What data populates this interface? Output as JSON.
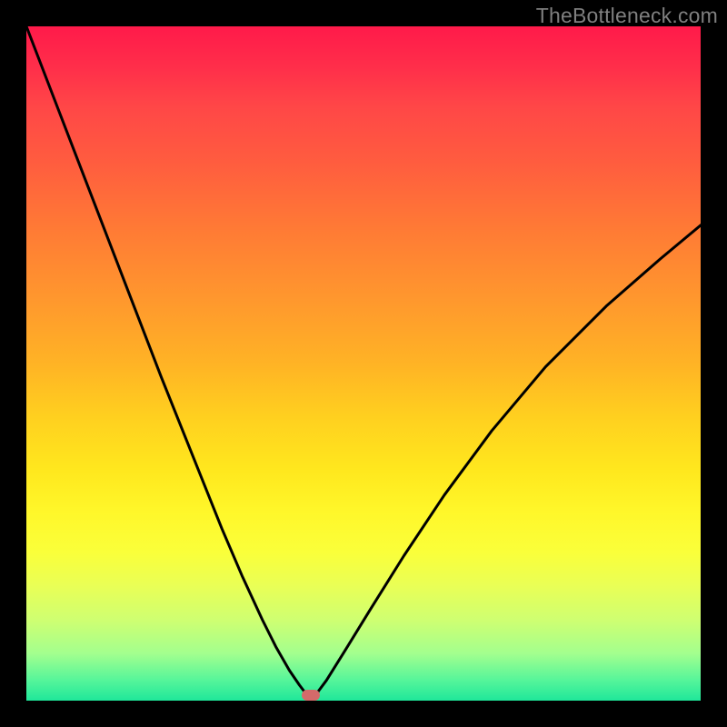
{
  "watermark": "TheBottleneck.com",
  "marker": {
    "cx_frac": 0.422,
    "cy_frac": 0.992
  },
  "chart_data": {
    "type": "line",
    "title": "",
    "xlabel": "",
    "ylabel": "",
    "xlim": [
      0,
      1
    ],
    "ylim": [
      0,
      1
    ],
    "series": [
      {
        "name": "curve",
        "x": [
          0.0,
          0.05,
          0.1,
          0.15,
          0.2,
          0.25,
          0.29,
          0.32,
          0.35,
          0.37,
          0.39,
          0.405,
          0.415,
          0.422,
          0.43,
          0.445,
          0.47,
          0.51,
          0.56,
          0.62,
          0.69,
          0.77,
          0.86,
          0.94,
          1.0
        ],
        "y": [
          1.0,
          0.87,
          0.74,
          0.61,
          0.48,
          0.355,
          0.255,
          0.185,
          0.12,
          0.08,
          0.045,
          0.023,
          0.01,
          0.003,
          0.01,
          0.03,
          0.07,
          0.135,
          0.215,
          0.305,
          0.4,
          0.495,
          0.585,
          0.655,
          0.705
        ]
      }
    ],
    "annotations": [
      {
        "kind": "marker",
        "x": 0.422,
        "y": 0.003,
        "color": "#d46a6a"
      }
    ],
    "background_gradient": {
      "direction": "vertical",
      "stops": [
        {
          "pos": 0.0,
          "color": "#ff1a4a"
        },
        {
          "pos": 0.5,
          "color": "#ffb325"
        },
        {
          "pos": 0.75,
          "color": "#fff72a"
        },
        {
          "pos": 1.0,
          "color": "#1fe79a"
        }
      ]
    }
  }
}
